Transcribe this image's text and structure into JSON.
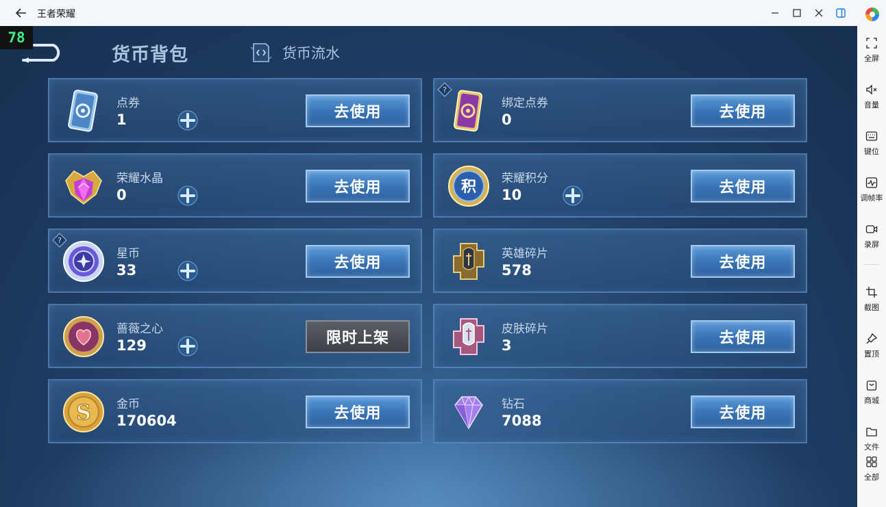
{
  "window": {
    "title": "王者荣耀",
    "controls": [
      "minimize-icon",
      "maximize-icon",
      "close-icon",
      "panel-toggle-icon"
    ]
  },
  "fps": "78",
  "tabs": {
    "wallet": "货币背包",
    "flow": "货币流水"
  },
  "cards": [
    {
      "name": "点券",
      "amount": "1",
      "plus": true,
      "button": "去使用",
      "icon": "voucher-icon",
      "help": false
    },
    {
      "name": "绑定点券",
      "amount": "0",
      "plus": false,
      "button": "去使用",
      "icon": "bound-voucher-icon",
      "help": true
    },
    {
      "name": "荣耀水晶",
      "amount": "0",
      "plus": true,
      "button": "去使用",
      "icon": "glory-crystal-icon",
      "help": false
    },
    {
      "name": "荣耀积分",
      "amount": "10",
      "plus": true,
      "button": "去使用",
      "icon": "glory-points-icon",
      "help": false
    },
    {
      "name": "星币",
      "amount": "33",
      "plus": true,
      "button": "去使用",
      "icon": "star-coin-icon",
      "help": true
    },
    {
      "name": "英雄碎片",
      "amount": "578",
      "plus": false,
      "button": "去使用",
      "icon": "hero-fragment-icon",
      "help": false
    },
    {
      "name": "蔷薇之心",
      "amount": "129",
      "plus": true,
      "button": "限时上架",
      "icon": "rose-heart-icon",
      "help": false
    },
    {
      "name": "皮肤碎片",
      "amount": "3",
      "plus": false,
      "button": "去使用",
      "icon": "skin-fragment-icon",
      "help": false
    },
    {
      "name": "金币",
      "amount": "170604",
      "plus": false,
      "button": "去使用",
      "icon": "gold-coin-icon",
      "help": false
    },
    {
      "name": "钻石",
      "amount": "7088",
      "plus": false,
      "button": "去使用",
      "icon": "diamond-icon",
      "help": false
    }
  ],
  "icon_glyph": {
    "glory_points": "积"
  },
  "sidebar": {
    "items": [
      {
        "label": "全屏",
        "icon": "fullscreen-icon"
      },
      {
        "label": "音量",
        "icon": "volume-icon"
      },
      {
        "label": "键位",
        "icon": "keyboard-icon"
      },
      {
        "label": "调帧率",
        "icon": "frame-rate-icon"
      },
      {
        "label": "录屏",
        "icon": "record-icon"
      },
      {
        "label": "截图",
        "icon": "screenshot-icon"
      },
      {
        "label": "置顶",
        "icon": "pin-icon"
      },
      {
        "label": "商城",
        "icon": "store-icon"
      },
      {
        "label": "文件",
        "icon": "folder-icon"
      },
      {
        "label": "全部",
        "icon": "grid-icon"
      }
    ]
  },
  "colors": {
    "background": "#1e3c63",
    "card_border": "#5f91c8",
    "button": "#3a75b7",
    "fps_text": "#3ff08a"
  }
}
